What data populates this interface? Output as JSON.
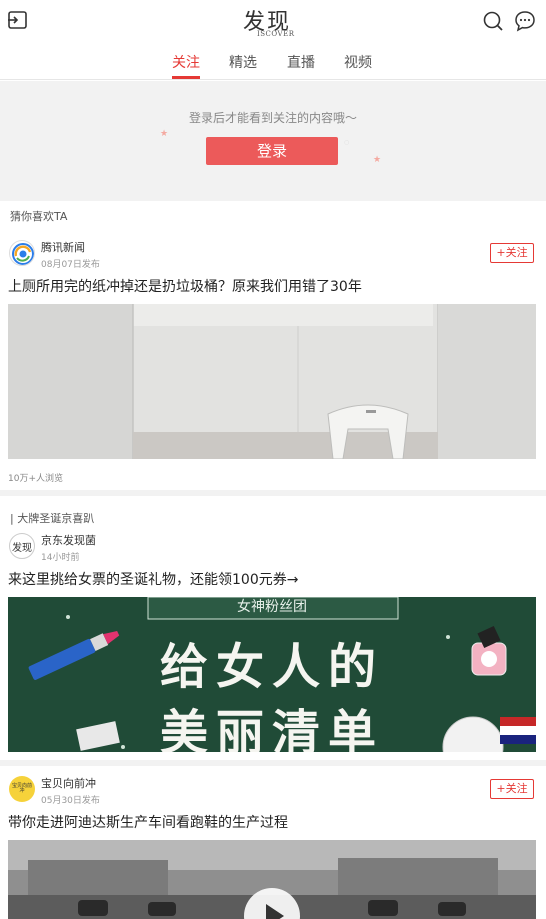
{
  "header": {
    "logo_main": "发现",
    "logo_sub": "ISCOVER",
    "menu_icon": "menu-icon",
    "search_icon": "search-icon",
    "message_icon": "message-icon"
  },
  "tabs": [
    {
      "label": "关注",
      "active": true
    },
    {
      "label": "精选",
      "active": false
    },
    {
      "label": "直播",
      "active": false
    },
    {
      "label": "视频",
      "active": false
    }
  ],
  "login_prompt": {
    "text": "登录后才能看到关注的内容哦～",
    "button": "登录"
  },
  "section_label": "猜你喜欢TA",
  "feed": [
    {
      "source": "腾讯新闻",
      "time": "08月07日发布",
      "follow": "+关注",
      "title": "上厕所用完的纸冲掉还是扔垃圾桶？原来我们用错了30年",
      "views": "10万+人浏览"
    },
    {
      "category": "| 大牌圣诞京喜趴",
      "source": "京东发现菌",
      "avatar_text": "发现",
      "time": "14小时前",
      "title": "来这里挑给女票的圣诞礼物，还能领100元券→",
      "banner_top": "女神粉丝团",
      "banner_line1": "给女人的",
      "banner_line2": "美丽清单"
    },
    {
      "source": "宝贝向前冲",
      "avatar_text": "宝贝向前冲",
      "time": "05月30日发布",
      "follow": "+关注",
      "title": "带你走进阿迪达斯生产车间看跑鞋的生产过程"
    }
  ],
  "colors": {
    "accent": "#e53935",
    "login_button": "#ec5a5a",
    "chalkboard": "#1f4a36"
  }
}
